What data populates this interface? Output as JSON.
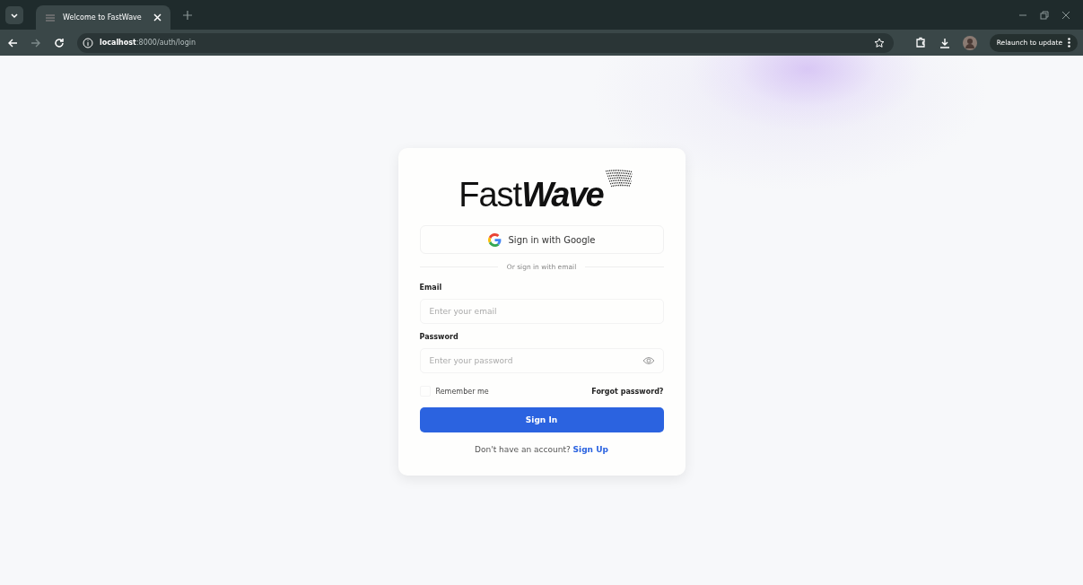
{
  "browser": {
    "tab": {
      "title": "Welcome to FastWave",
      "selected": true
    },
    "url_host": "localhost",
    "url_path": ":8000/auth/login",
    "relaunch": "Relaunch to update"
  },
  "login": {
    "logo": "Fast**Wave**",
    "google_button": "Sign in with Google",
    "divider": "Or sign in with email",
    "email": {
      "label": "Email",
      "placeholder": "Enter your email"
    },
    "password": {
      "label": "Password",
      "placeholder": "Enter your password"
    },
    "remember": {
      "label": "Remember me",
      "checked": false
    },
    "forgot": "Forgot password?",
    "submit": "Sign In",
    "signup_prompt": "Don't have an account?",
    "signup_link": "Sign Up"
  }
}
